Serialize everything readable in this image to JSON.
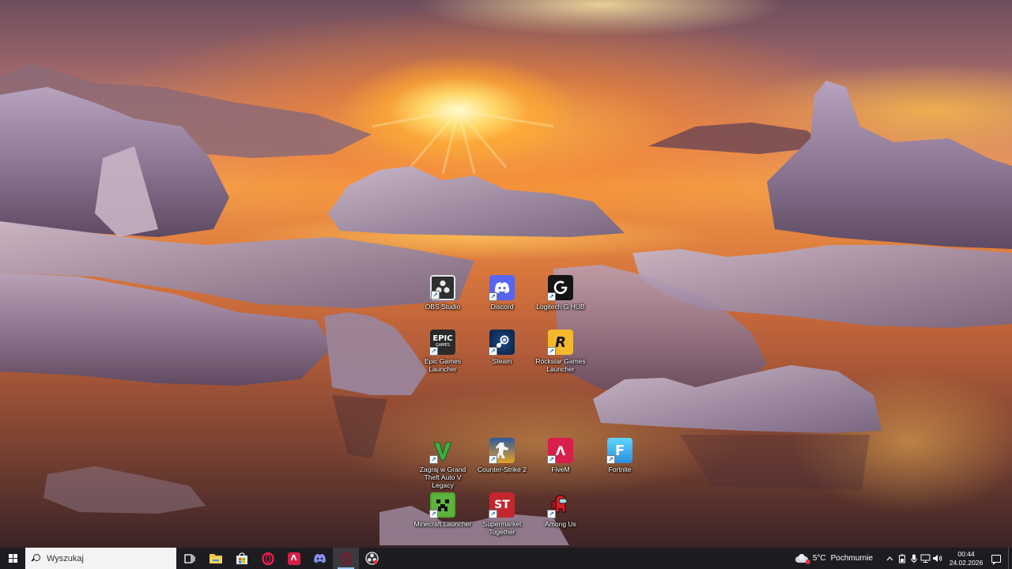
{
  "desktop": {
    "icons": [
      {
        "label": "OBS Studio",
        "icon": "obs-icon"
      },
      {
        "label": "Discord",
        "icon": "discord-icon"
      },
      {
        "label": "Logitech G HUB",
        "icon": "logitech-icon"
      },
      {
        "label": "Epic Games Launcher",
        "icon": "epic-games-icon"
      },
      {
        "label": "Steam",
        "icon": "steam-icon"
      },
      {
        "label": "Rockstar Games Launcher",
        "icon": "rockstar-icon"
      },
      {
        "label": "Zagraj w Grand Theft Auto V Legacy",
        "icon": "gta-v-icon"
      },
      {
        "label": "Counter-Strike 2",
        "icon": "counter-strike-icon"
      },
      {
        "label": "FiveM",
        "icon": "fivem-icon"
      },
      {
        "label": "Fortnite",
        "icon": "fortnite-icon"
      },
      {
        "label": "Minecraft Launcher",
        "icon": "minecraft-icon"
      },
      {
        "label": "Supermarket Together",
        "icon": "supermarket-together-icon"
      },
      {
        "label": "Among Us",
        "icon": "among-us-icon"
      }
    ],
    "icon_glyphs": {
      "epic_top": "EPIC",
      "epic_bottom": "GAMES",
      "rockstar": "R",
      "fivem": "Λ",
      "fortnite": "F",
      "supermarket": "ST",
      "shortcut_arrow": "↗"
    }
  },
  "taskbar": {
    "search_placeholder": "Wyszukaj",
    "apps": [
      {
        "name": "task-view",
        "icon": "task-view-icon"
      },
      {
        "name": "file-explorer",
        "icon": "folder-icon"
      },
      {
        "name": "microsoft-store",
        "icon": "store-icon"
      },
      {
        "name": "opera-gx",
        "icon": "opera-icon"
      },
      {
        "name": "fivem",
        "icon": "fivem-icon"
      },
      {
        "name": "discord",
        "icon": "discord-icon"
      },
      {
        "name": "opera-gx-active",
        "icon": "opera-icon",
        "active": true
      },
      {
        "name": "obs-studio",
        "icon": "obs-icon"
      }
    ],
    "weather": {
      "temperature": "5°C",
      "condition": "Pochmurnie"
    },
    "tray_icons": [
      "chevron-up-icon",
      "battery-icon",
      "microphone-icon",
      "network-icon",
      "volume-icon"
    ],
    "clock": {
      "time": "00:44",
      "date": "24.02.2026"
    }
  },
  "colors": {
    "taskbar_bg": "#1d1d21",
    "discord": "#5865f2",
    "fivem": "#d81e4a",
    "active_indicator": "#9ec4ff"
  }
}
